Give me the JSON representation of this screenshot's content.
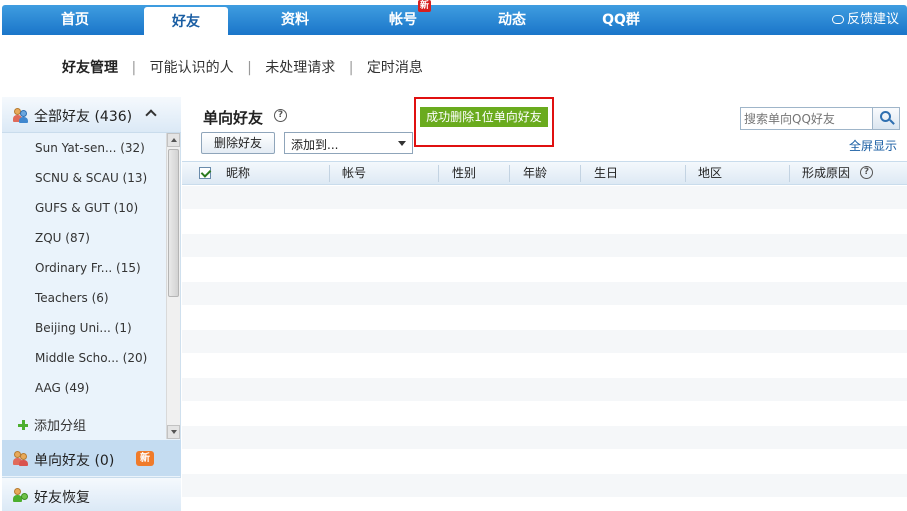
{
  "nav": {
    "tabs": [
      {
        "label": "首页"
      },
      {
        "label": "好友"
      },
      {
        "label": "资料"
      },
      {
        "label": "帐号",
        "badge": "新"
      },
      {
        "label": "动态"
      },
      {
        "label": "QQ群"
      }
    ],
    "active_tab": "好友",
    "feedback": "反馈建议"
  },
  "subnav": {
    "items": [
      "好友管理",
      "可能认识的人",
      "未处理请求",
      "定时消息"
    ],
    "active": "好友管理"
  },
  "sidebar": {
    "all_friends": "全部好友 (436)",
    "groups": [
      "Sun Yat-sen... (32)",
      "SCNU & SCAU (13)",
      "GUFS & GUT (10)",
      "ZQU (87)",
      "Ordinary Fr... (15)",
      "Teachers (6)",
      "Beijing Uni... (1)",
      "Middle Scho... (20)",
      "AAG (49)"
    ],
    "add_group": "添加分组",
    "one_way": "单向好友 (0)",
    "one_way_badge": "新",
    "restore": "好友恢复"
  },
  "main": {
    "title": "单向好友",
    "help": "?",
    "success_message": "成功删除1位单向好友",
    "delete_button": "删除好友",
    "add_to_select": "添加到...",
    "search_placeholder": "搜索单向QQ好友",
    "fullscreen": "全屏显示",
    "columns": [
      "昵称",
      "帐号",
      "性别",
      "年龄",
      "生日",
      "地区",
      "形成原因"
    ]
  },
  "colors": {
    "nav_blue": "#1a75c9",
    "success_green": "#6aab1e",
    "highlight_red": "#e01010",
    "badge_orange": "#f07b2a"
  }
}
